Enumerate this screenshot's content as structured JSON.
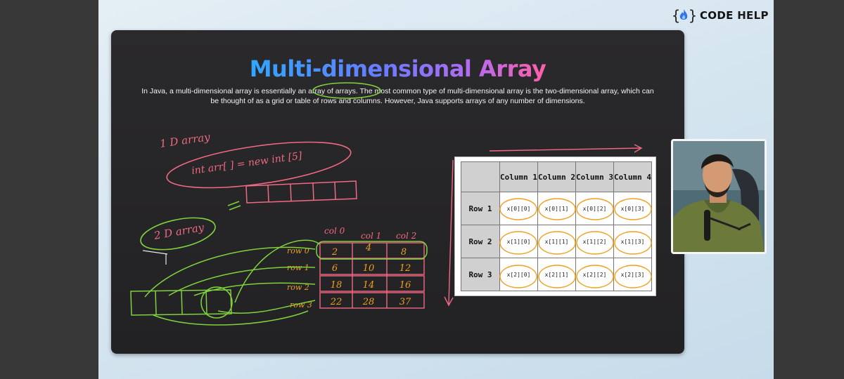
{
  "brand": {
    "name_main": "CODE",
    "name_accent": " HELP",
    "icon": "flame-code-icon"
  },
  "slide": {
    "title": "Multi-dimensional Array",
    "description": "In Java, a multi-dimensional array is essentially an array of arrays. The most common type of multi-dimensional array is the two-dimensional array, which can be thought of as a grid or table of rows and columns. However, Java supports arrays of any number of dimensions."
  },
  "handwriting": {
    "one_d_label": "1 D array",
    "one_d_code": "int arr[ ] = new int [5]",
    "two_d_label": "2 D array",
    "col_labels": [
      "col 0",
      "col 1",
      "col 2"
    ],
    "row_labels": [
      "row 0",
      "row 1",
      "row 2",
      "row 3"
    ],
    "grid": [
      [
        "2",
        "4",
        "8"
      ],
      [
        "6",
        "10",
        "12"
      ],
      [
        "18",
        "14",
        "16"
      ],
      [
        "22",
        "28",
        "37"
      ]
    ]
  },
  "table": {
    "headers": [
      "Column 1",
      "Column 2",
      "Column 3",
      "Column 4"
    ],
    "rows": [
      {
        "label": "Row 1",
        "cells": [
          "x[0][0]",
          "x[0][1]",
          "x[0][2]",
          "x[0][3]"
        ]
      },
      {
        "label": "Row 2",
        "cells": [
          "x[1][0]",
          "x[1][1]",
          "x[1][2]",
          "x[1][3]"
        ]
      },
      {
        "label": "Row 3",
        "cells": [
          "x[2][0]",
          "x[2][1]",
          "x[2][2]",
          "x[2][3]"
        ]
      }
    ]
  },
  "colors": {
    "ink_pink": "#f06a82",
    "ink_green": "#7fd23f",
    "ink_orange": "#f0a020",
    "ink_white": "#e8e8e8"
  }
}
